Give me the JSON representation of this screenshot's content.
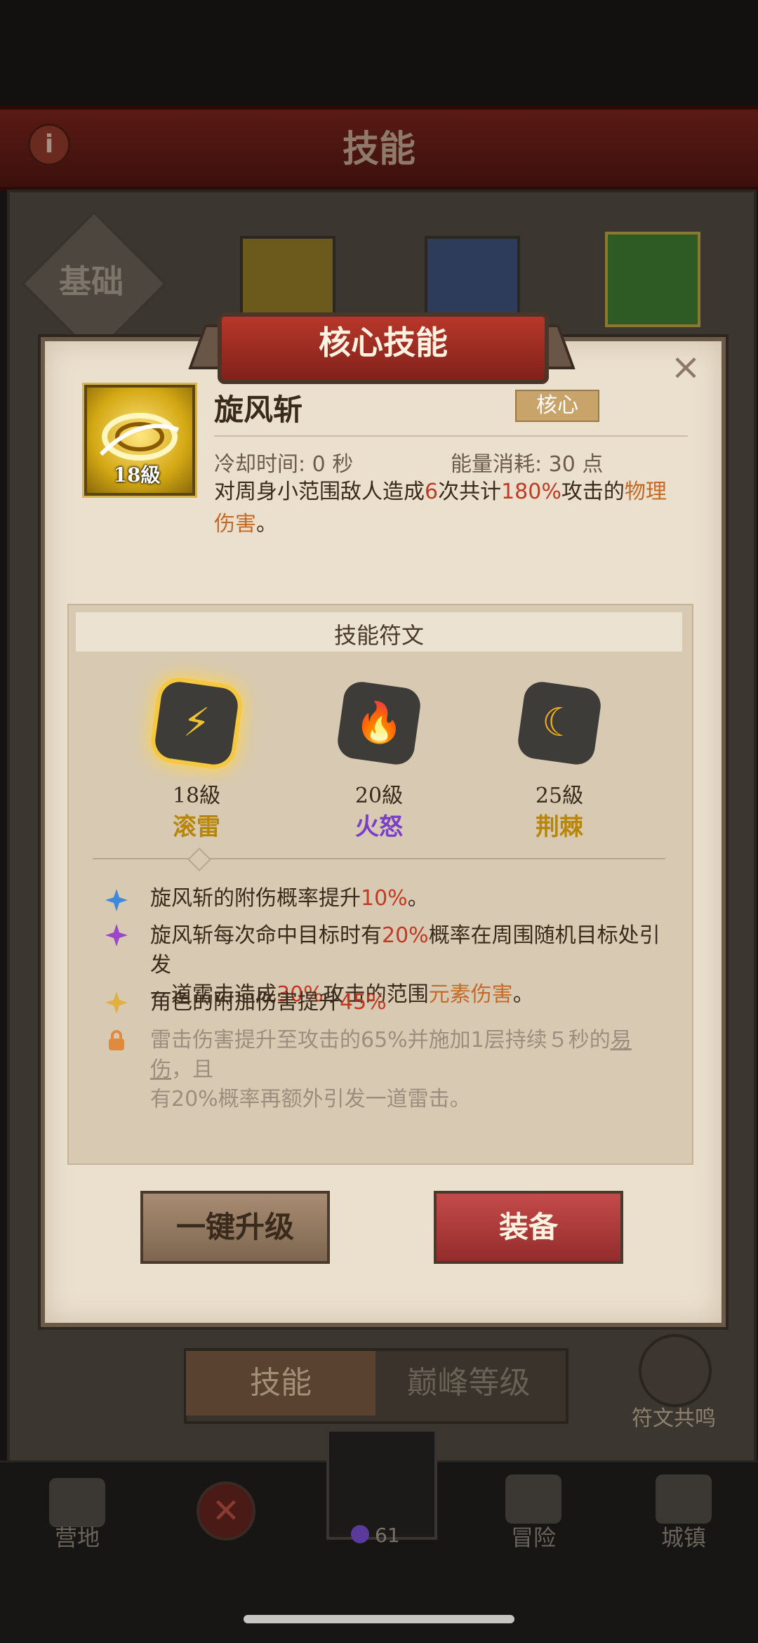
{
  "header": {
    "title": "技能",
    "info_icon": "i"
  },
  "tabs": {
    "basic_label": "基础"
  },
  "dialog": {
    "banner_title": "核心技能",
    "close_icon": "×",
    "skill": {
      "name": "旋风斩",
      "level": "18級",
      "badge": "核心",
      "cooldown": "冷却时间: 0 秒",
      "energy": "能量消耗: 30 点",
      "desc_parts": [
        "对周身小范围敌人造成",
        "6",
        "次共计",
        "180%",
        "攻击的",
        "物理伤害",
        "。"
      ]
    },
    "rune_section": {
      "title": "技能符文",
      "runes": [
        {
          "level": "18級",
          "name": "滚雷",
          "color": "#b8860b",
          "symbol": "⚡"
        },
        {
          "level": "20級",
          "name": "火怒",
          "color": "#7a3fc8",
          "symbol": "🔥"
        },
        {
          "level": "25級",
          "name": "荆棘",
          "color": "#b8860b",
          "symbol": "☾"
        }
      ],
      "effects": [
        {
          "icon": "blue-star",
          "parts": [
            "旋风斩的附伤概率提升",
            "10%",
            "。"
          ]
        },
        {
          "icon": "purple-star",
          "parts": [
            "旋风斩每次命中目标时有",
            "20%",
            "概率在周围随机目标处引发",
            "一道雷击造成",
            "30%",
            "攻击的范围",
            "元素伤害",
            "。"
          ]
        },
        {
          "icon": "yellow-star",
          "parts": [
            "角色的附加伤害提升",
            "45%"
          ]
        },
        {
          "icon": "lock",
          "parts": [
            "雷击伤害提升至攻击的65%并施加1层持续５秒的",
            "易伤",
            "，且",
            "有20%概率再额外引发一道雷击。"
          ]
        }
      ]
    },
    "buttons": {
      "upgrade": "一键升级",
      "equip": "装备"
    }
  },
  "bottom_tabs": {
    "skills": "技能",
    "peak": "巅峰等级",
    "rune_resonance": "符文共鸣"
  },
  "nav": {
    "camp": "营地",
    "currency": "61",
    "adventure": "冒险",
    "town": "城镇"
  }
}
